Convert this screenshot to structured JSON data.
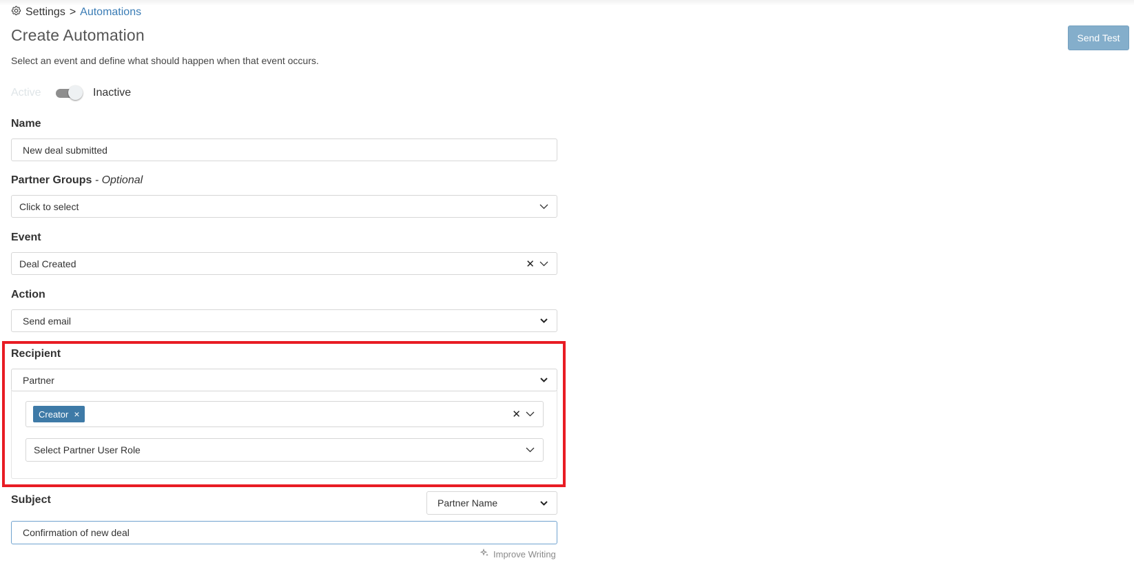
{
  "breadcrumb": {
    "settings": "Settings",
    "separator": ">",
    "automations": "Automations",
    "icon": "gear-icon"
  },
  "page": {
    "title": "Create Automation",
    "subtitle": "Select an event and define what should happen when that event occurs.",
    "send_test_label": "Send Test"
  },
  "status": {
    "active_label": "Active",
    "inactive_label": "Inactive",
    "is_active": false
  },
  "form": {
    "name": {
      "label": "Name",
      "value": "New deal submitted"
    },
    "partner_groups": {
      "label": "Partner Groups",
      "optional": "- Optional",
      "placeholder": "Click to select"
    },
    "event": {
      "label": "Event",
      "value": "Deal Created"
    },
    "action": {
      "label": "Action",
      "value": "Send email"
    },
    "recipient": {
      "label": "Recipient",
      "value": "Partner",
      "tags": [
        {
          "label": "Creator",
          "remove": "×"
        }
      ],
      "role_placeholder": "Select Partner User Role"
    },
    "subject": {
      "label": "Subject",
      "insert_field_value": "Partner Name",
      "value": "Confirmation of new deal",
      "improve_label": "Improve Writing"
    }
  },
  "colors": {
    "accent": "#3e7aa7",
    "link": "#3a7cb5",
    "highlight_border": "#e81c24",
    "button": "#84aecb"
  }
}
